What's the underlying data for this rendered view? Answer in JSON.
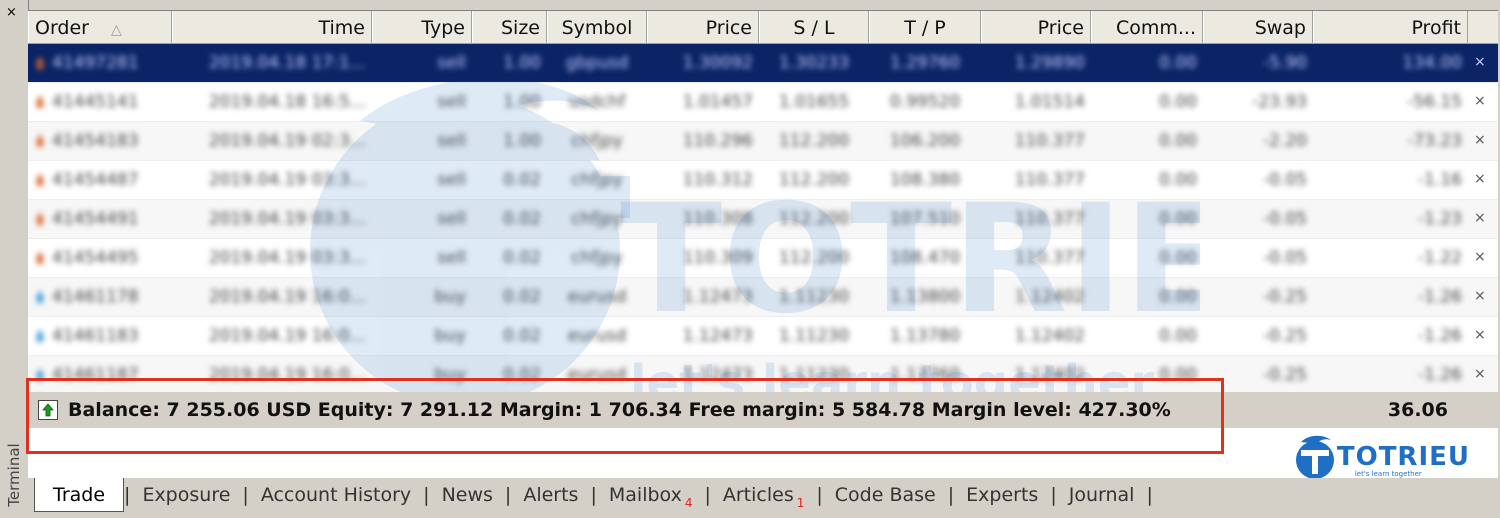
{
  "terminal": {
    "title": "Terminal",
    "close_label": "×"
  },
  "columns": [
    {
      "label": "Order",
      "align": "left",
      "sort": "△"
    },
    {
      "label": "Time",
      "align": "right"
    },
    {
      "label": "Type",
      "align": "right"
    },
    {
      "label": "Size",
      "align": "right"
    },
    {
      "label": "Symbol",
      "align": "center"
    },
    {
      "label": "Price",
      "align": "right"
    },
    {
      "label": "S / L",
      "align": "center"
    },
    {
      "label": "T / P",
      "align": "center"
    },
    {
      "label": "Price",
      "align": "right"
    },
    {
      "label": "Comm...",
      "align": "right"
    },
    {
      "label": "Swap",
      "align": "right"
    },
    {
      "label": "Profit",
      "align": "right"
    }
  ],
  "rows": [
    {
      "order": "41497281",
      "time": "2019.04.18 17:1...",
      "type": "sell",
      "size": "1.00",
      "symbol": "gbpusd",
      "price": "1.30092",
      "sl": "1.30233",
      "tp": "1.29760",
      "price2": "1.29890",
      "comm": "0.00",
      "swap": "-5.90",
      "profit": "134.00",
      "icon": "sell"
    },
    {
      "order": "41445141",
      "time": "2019.04.18 16:5...",
      "type": "sell",
      "size": "1.00",
      "symbol": "usdchf",
      "price": "1.01457",
      "sl": "1.01655",
      "tp": "0.99520",
      "price2": "1.01514",
      "comm": "0.00",
      "swap": "-23.93",
      "profit": "-56.15",
      "icon": "sell"
    },
    {
      "order": "41454183",
      "time": "2019.04.19 02:3...",
      "type": "sell",
      "size": "1.00",
      "symbol": "chfjpy",
      "price": "110.296",
      "sl": "112.200",
      "tp": "106.200",
      "price2": "110.377",
      "comm": "0.00",
      "swap": "-2.20",
      "profit": "-73.23",
      "icon": "sell"
    },
    {
      "order": "41454487",
      "time": "2019.04.19 03:3...",
      "type": "sell",
      "size": "0.02",
      "symbol": "chfjpy",
      "price": "110.312",
      "sl": "112.200",
      "tp": "108.380",
      "price2": "110.377",
      "comm": "0.00",
      "swap": "-0.05",
      "profit": "-1.16",
      "icon": "sell"
    },
    {
      "order": "41454491",
      "time": "2019.04.19 03:3...",
      "type": "sell",
      "size": "0.02",
      "symbol": "chfjpy",
      "price": "110.308",
      "sl": "112.200",
      "tp": "107.510",
      "price2": "110.377",
      "comm": "0.00",
      "swap": "-0.05",
      "profit": "-1.23",
      "icon": "sell"
    },
    {
      "order": "41454495",
      "time": "2019.04.19 03:3...",
      "type": "sell",
      "size": "0.02",
      "symbol": "chfjpy",
      "price": "110.309",
      "sl": "112.200",
      "tp": "108.470",
      "price2": "110.377",
      "comm": "0.00",
      "swap": "-0.05",
      "profit": "-1.22",
      "icon": "sell"
    },
    {
      "order": "41461178",
      "time": "2019.04.19 16:0...",
      "type": "buy",
      "size": "0.02",
      "symbol": "eurusd",
      "price": "1.12473",
      "sl": "1.11230",
      "tp": "1.13800",
      "price2": "1.12402",
      "comm": "0.00",
      "swap": "-0.25",
      "profit": "-1.26",
      "icon": "buy"
    },
    {
      "order": "41461183",
      "time": "2019.04.19 16:0...",
      "type": "buy",
      "size": "0.02",
      "symbol": "eurusd",
      "price": "1.12473",
      "sl": "1.11230",
      "tp": "1.13780",
      "price2": "1.12402",
      "comm": "0.00",
      "swap": "-0.25",
      "profit": "-1.26",
      "icon": "buy"
    },
    {
      "order": "41461187",
      "time": "2019.04.19 16:0...",
      "type": "buy",
      "size": "0.02",
      "symbol": "eurusd",
      "price": "1.12473",
      "sl": "1.11230",
      "tp": "1.13760",
      "price2": "1.12402",
      "comm": "0.00",
      "swap": "-0.25",
      "profit": "-1.26",
      "icon": "buy"
    }
  ],
  "summary": {
    "text": "Balance: 7 255.06 USD  Equity: 7 291.12  Margin: 1 706.34  Free margin: 5 584.78  Margin level: 427.30%",
    "profit": "36.06"
  },
  "tabs": [
    {
      "label": "Trade",
      "active": true
    },
    {
      "label": "Exposure"
    },
    {
      "label": "Account History"
    },
    {
      "label": "News"
    },
    {
      "label": "Alerts"
    },
    {
      "label": "Mailbox",
      "badge": "4"
    },
    {
      "label": "Articles",
      "badge": "1"
    },
    {
      "label": "Code Base"
    },
    {
      "label": "Experts"
    },
    {
      "label": "Journal"
    }
  ],
  "logo": {
    "text": "TOTRIEU",
    "tagline": "let's learn together"
  },
  "watermark": {
    "text": "TOTRIEU",
    "tagline": "let's learn together"
  },
  "colors": {
    "accent": "#1f6fc4",
    "selected_row": "#0a2466",
    "highlight": "#e0301e",
    "badge": "#e02020"
  }
}
